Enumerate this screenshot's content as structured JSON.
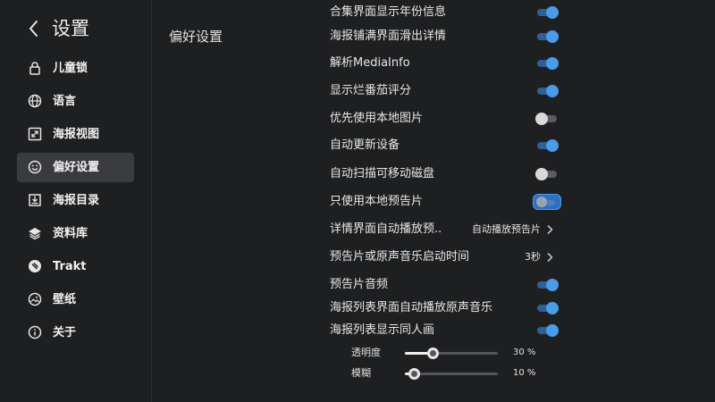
{
  "header": {
    "title": "设置",
    "back_icon": "chevron-left-icon"
  },
  "sidebar": {
    "items": [
      {
        "label": "儿童锁",
        "icon": "lock-icon",
        "active": false
      },
      {
        "label": "语言",
        "icon": "globe-icon",
        "active": false
      },
      {
        "label": "海报视图",
        "icon": "expand-icon",
        "active": false
      },
      {
        "label": "偏好设置",
        "icon": "smiley-icon",
        "active": true
      },
      {
        "label": "海报目录",
        "icon": "download-box-icon",
        "active": false
      },
      {
        "label": "资料库",
        "icon": "layers-icon",
        "active": false
      },
      {
        "label": "Trakt",
        "icon": "trakt-icon",
        "active": false
      },
      {
        "label": "壁纸",
        "icon": "image-icon",
        "active": false
      },
      {
        "label": "关于",
        "icon": "info-icon",
        "active": false
      }
    ]
  },
  "main": {
    "section_title": "偏好设置",
    "settings": [
      {
        "label": "合集界面显示年份信息",
        "type": "toggle",
        "on": true
      },
      {
        "label": "海报铺满界面滑出详情",
        "type": "toggle",
        "on": true
      },
      {
        "label": "解析MediaInfo",
        "type": "toggle",
        "on": true
      },
      {
        "label": "显示烂番茄评分",
        "type": "toggle",
        "on": true
      },
      {
        "label": "优先使用本地图片",
        "type": "toggle",
        "on": false
      },
      {
        "label": "自动更新设备",
        "type": "toggle",
        "on": true
      },
      {
        "label": "自动扫描可移动磁盘",
        "type": "toggle",
        "on": false
      },
      {
        "label": "只使用本地预告片",
        "type": "toggle",
        "on": false,
        "focused": true
      },
      {
        "label": "详情界面自动播放预..",
        "type": "select",
        "value": "自动播放预告片"
      },
      {
        "label": "预告片或原声音乐启动时间",
        "type": "select",
        "value": "3秒"
      },
      {
        "label": "预告片音频",
        "type": "toggle",
        "on": true
      },
      {
        "label": "海报列表界面自动播放原声音乐",
        "type": "toggle",
        "on": true
      },
      {
        "label": "海报列表显示同人画",
        "type": "toggle",
        "on": true
      }
    ],
    "sliders": [
      {
        "label": "透明度",
        "value": 30,
        "value_text": "30 %"
      },
      {
        "label": "模糊",
        "value": 10,
        "value_text": "10 %"
      }
    ]
  },
  "colors": {
    "background": "#1e1f21",
    "active_item": "#3a3b3f",
    "toggle_on": "#4a9be8",
    "toggle_off": "#d8d8d8"
  }
}
